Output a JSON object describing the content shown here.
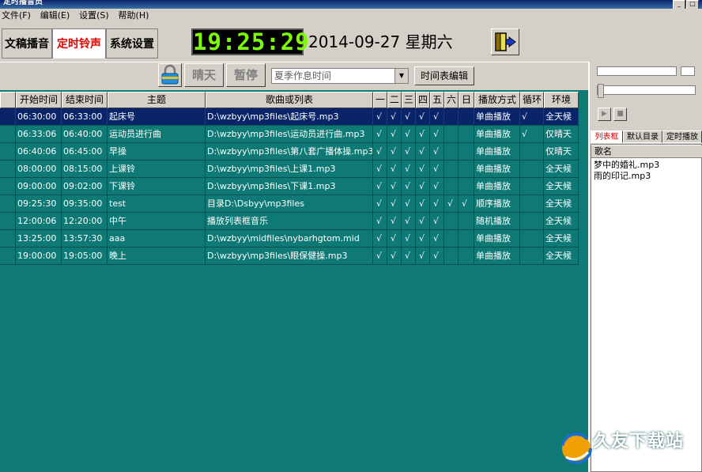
{
  "window": {
    "title": "定时播音员"
  },
  "menu": [
    "文件(F)",
    "编辑(E)",
    "设置(S)",
    "帮助(H)"
  ],
  "tabs": [
    {
      "label": "文稿播音",
      "active": false
    },
    {
      "label": "定时铃声",
      "active": true
    },
    {
      "label": "系统设置",
      "active": false
    }
  ],
  "clock": {
    "time": "19:25:29",
    "date": "2014-09-27 星期六"
  },
  "toolbar": {
    "sunny_label": "晴天",
    "pause_label": "暂停",
    "schedule_value": "夏季作息时间",
    "edit_label": "时间表编辑"
  },
  "table": {
    "headers": [
      "开始时间",
      "结束时间",
      "主题",
      "歌曲或列表",
      "一",
      "二",
      "三",
      "四",
      "五",
      "六",
      "日",
      "播放方式",
      "循环",
      "环境"
    ],
    "rows": [
      [
        "06:30:00",
        "06:33:00",
        "起床号",
        "D:\\wzbyy\\mp3files\\起床号.mp3",
        "√",
        "√",
        "√",
        "√",
        "√",
        "",
        "",
        "单曲播放",
        "√",
        "全天候"
      ],
      [
        "06:33:06",
        "06:40:00",
        "运动员进行曲",
        "D:\\wzbyy\\mp3files\\运动员进行曲.mp3",
        "√",
        "√",
        "√",
        "√",
        "√",
        "",
        "",
        "单曲播放",
        "√",
        "仅晴天"
      ],
      [
        "06:40:06",
        "06:45:00",
        "早操",
        "D:\\wzbyy\\mp3files\\第八套广播体操.mp3",
        "√",
        "√",
        "√",
        "√",
        "√",
        "",
        "",
        "单曲播放",
        "",
        "仅晴天"
      ],
      [
        "08:00:00",
        "08:15:00",
        "上课铃",
        "D:\\wzbyy\\mp3files\\上课1.mp3",
        "√",
        "√",
        "√",
        "√",
        "√",
        "",
        "",
        "单曲播放",
        "",
        "全天候"
      ],
      [
        "09:00:00",
        "09:02:00",
        "下课铃",
        "D:\\wzbyy\\mp3files\\下课1.mp3",
        "√",
        "√",
        "√",
        "√",
        "√",
        "",
        "",
        "单曲播放",
        "",
        "全天候"
      ],
      [
        "09:25:30",
        "09:35:00",
        "test",
        "目录D:\\Dsbyy\\mp3files",
        "√",
        "√",
        "√",
        "√",
        "√",
        "√",
        "√",
        "顺序播放",
        "",
        "全天候"
      ],
      [
        "12:00:06",
        "12:20:00",
        "中午",
        "播放列表框音乐",
        "√",
        "√",
        "√",
        "√",
        "√",
        "",
        "",
        "随机播放",
        "",
        "全天候"
      ],
      [
        "13:25:00",
        "13:57:30",
        "aaa",
        "D:\\wzbyy\\midfiles\\nybarhgtom.mid",
        "√",
        "√",
        "√",
        "√",
        "√",
        "",
        "",
        "单曲播放",
        "",
        "全天候"
      ],
      [
        "19:00:00",
        "19:05:00",
        "晚上",
        "D:\\wzbyy\\mp3files\\眼保健操.mp3",
        "√",
        "√",
        "√",
        "√",
        "√",
        "",
        "",
        "单曲播放",
        "",
        "全天候"
      ]
    ],
    "selected_row": 0
  },
  "right_panel": {
    "tabs": [
      "列表框",
      "默认目录",
      "定时播放"
    ],
    "list_header": "歌名",
    "list_items": [
      "梦中的婚礼.mp3",
      "雨的印记.mp3"
    ]
  },
  "watermark": {
    "name": "久友下载站",
    "url": "Www.9UPK.Com"
  },
  "colors": {
    "grid_bg": "#0f7a75",
    "selected_row": "#0a246a",
    "clock_digits": "#7cfc00"
  }
}
